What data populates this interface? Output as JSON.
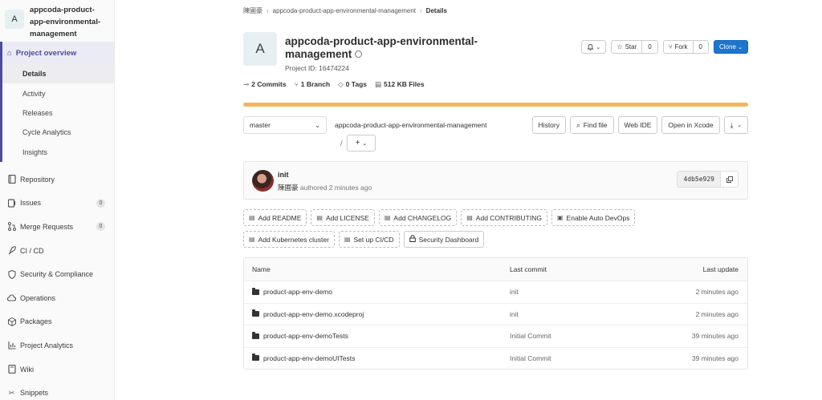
{
  "sidebar": {
    "avatar_letter": "A",
    "project_title": "appcoda-product-app-environmental-management",
    "overview_label": "Project overview",
    "sub_items": [
      {
        "label": "Details",
        "active": true
      },
      {
        "label": "Activity"
      },
      {
        "label": "Releases"
      },
      {
        "label": "Cycle Analytics"
      },
      {
        "label": "Insights"
      }
    ],
    "items": [
      {
        "label": "Repository",
        "icon": "book-icon"
      },
      {
        "label": "Issues",
        "icon": "issues-icon",
        "badge": "0"
      },
      {
        "label": "Merge Requests",
        "icon": "merge-request-icon",
        "badge": "0"
      },
      {
        "label": "CI / CD",
        "icon": "rocket-icon"
      },
      {
        "label": "Security & Compliance",
        "icon": "shield-icon"
      },
      {
        "label": "Operations",
        "icon": "cloud-icon"
      },
      {
        "label": "Packages",
        "icon": "package-icon"
      },
      {
        "label": "Project Analytics",
        "icon": "chart-icon"
      },
      {
        "label": "Wiki",
        "icon": "book-open-icon"
      },
      {
        "label": "Snippets",
        "icon": "scissors-icon"
      }
    ]
  },
  "breadcrumb": {
    "user": "陳圃豪",
    "project": "appcoda-product-app-environmental-management",
    "current": "Details"
  },
  "project": {
    "avatar_letter": "A",
    "name": "appcoda-product-app-environmental-management",
    "id_text": "Project ID: 16474224"
  },
  "header_buttons": {
    "notify_icon": "bell-icon",
    "star_label": "Star",
    "star_count": "0",
    "fork_label": "Fork",
    "fork_count": "0",
    "clone_label": "Clone"
  },
  "stats": {
    "commits": "2",
    "commits_label": "Commits",
    "branches": "1",
    "branches_label": "Branch",
    "tags": "0",
    "tags_label": "Tags",
    "files_size": "512 KB",
    "files_label": "Files"
  },
  "language_bar": {
    "fill_fraction": 1.0,
    "color": "#f1b65a"
  },
  "toolbar": {
    "branch": "master",
    "path": "appcoda-product-app-environmental-management",
    "slash": "/",
    "history": "History",
    "find_file": "Find file",
    "web_ide": "Web IDE",
    "open_xcode": "Open in Xcode"
  },
  "last_commit": {
    "title": "init",
    "author": "陳圃豪",
    "meta": "authored 2 minutes ago",
    "sha": "4db5e929"
  },
  "suggestions": {
    "row1": [
      "Add README",
      "Add LICENSE",
      "Add CHANGELOG",
      "Add CONTRIBUTING",
      "Enable Auto DevOps"
    ],
    "row2": [
      "Add Kubernetes cluster",
      "Set up CI/CD",
      "Security Dashboard"
    ]
  },
  "files_table": {
    "headers": {
      "name": "Name",
      "commit": "Last commit",
      "update": "Last update"
    },
    "rows": [
      {
        "name": "product-app-env-demo",
        "commit": "init",
        "update": "2 minutes ago"
      },
      {
        "name": "product-app-env-demo.xcodeproj",
        "commit": "init",
        "update": "2 minutes ago"
      },
      {
        "name": "product-app-env-demoTests",
        "commit": "Initial Commit",
        "update": "39 minutes ago"
      },
      {
        "name": "product-app-env-demoUITests",
        "commit": "Initial Commit",
        "update": "39 minutes ago"
      }
    ]
  }
}
